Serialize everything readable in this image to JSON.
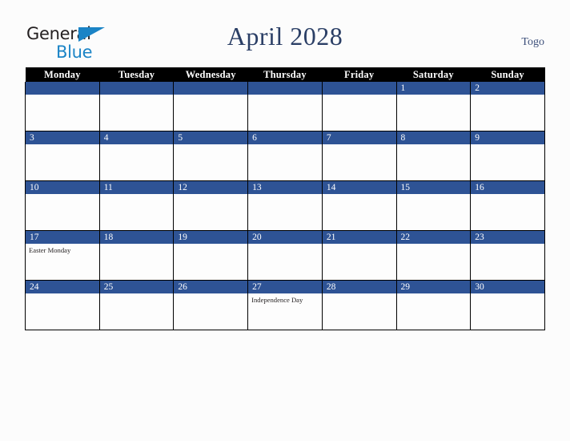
{
  "brand": {
    "word1": "General",
    "word2": "Blue",
    "triangle_color": "#1b84c6",
    "word1_color": "#231f20"
  },
  "header": {
    "title": "April 2028",
    "country": "Togo",
    "title_color": "#2b3f66"
  },
  "theme": {
    "day_bar_color": "#2e5395",
    "header_row_color": "#000000",
    "grid_line_color": "#000000",
    "cell_background": "#fdfdfd",
    "page_background": "#fcfcfc"
  },
  "calendar": {
    "weekday_headers": [
      "Monday",
      "Tuesday",
      "Wednesday",
      "Thursday",
      "Friday",
      "Saturday",
      "Sunday"
    ],
    "weeks": [
      [
        {
          "date": "",
          "events": []
        },
        {
          "date": "",
          "events": []
        },
        {
          "date": "",
          "events": []
        },
        {
          "date": "",
          "events": []
        },
        {
          "date": "",
          "events": []
        },
        {
          "date": "1",
          "events": []
        },
        {
          "date": "2",
          "events": []
        }
      ],
      [
        {
          "date": "3",
          "events": []
        },
        {
          "date": "4",
          "events": []
        },
        {
          "date": "5",
          "events": []
        },
        {
          "date": "6",
          "events": []
        },
        {
          "date": "7",
          "events": []
        },
        {
          "date": "8",
          "events": []
        },
        {
          "date": "9",
          "events": []
        }
      ],
      [
        {
          "date": "10",
          "events": []
        },
        {
          "date": "11",
          "events": []
        },
        {
          "date": "12",
          "events": []
        },
        {
          "date": "13",
          "events": []
        },
        {
          "date": "14",
          "events": []
        },
        {
          "date": "15",
          "events": []
        },
        {
          "date": "16",
          "events": []
        }
      ],
      [
        {
          "date": "17",
          "events": [
            "Easter Monday"
          ]
        },
        {
          "date": "18",
          "events": []
        },
        {
          "date": "19",
          "events": []
        },
        {
          "date": "20",
          "events": []
        },
        {
          "date": "21",
          "events": []
        },
        {
          "date": "22",
          "events": []
        },
        {
          "date": "23",
          "events": []
        }
      ],
      [
        {
          "date": "24",
          "events": []
        },
        {
          "date": "25",
          "events": []
        },
        {
          "date": "26",
          "events": []
        },
        {
          "date": "27",
          "events": [
            "Independence Day"
          ]
        },
        {
          "date": "28",
          "events": []
        },
        {
          "date": "29",
          "events": []
        },
        {
          "date": "30",
          "events": []
        }
      ]
    ]
  }
}
